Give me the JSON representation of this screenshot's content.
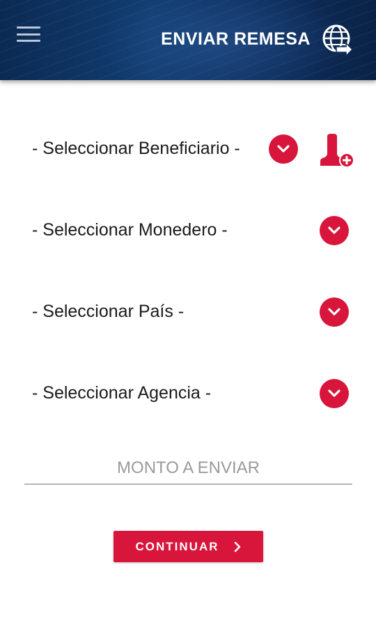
{
  "colors": {
    "header_bg": "#0e2f5f",
    "accent_red": "#d8153a",
    "text_dark": "#1a1a1a",
    "placeholder": "#9a9a9a"
  },
  "header": {
    "menu_icon": "hamburger-menu-icon",
    "title": "ENVIAR REMESA",
    "globe_icon": "globe-send-icon"
  },
  "form": {
    "beneficiario": {
      "label": "- Seleccionar Beneficiario -",
      "icon": "chevron-down-icon"
    },
    "add_beneficiario_icon": "add-user-icon",
    "monedero": {
      "label": "- Seleccionar Monedero -",
      "icon": "chevron-down-icon"
    },
    "pais": {
      "label": "- Seleccionar País -",
      "icon": "chevron-down-icon"
    },
    "agencia": {
      "label": "- Seleccionar Agencia -",
      "icon": "chevron-down-icon"
    },
    "amount": {
      "placeholder": "MONTO A ENVIAR",
      "value": ""
    },
    "continue_button": {
      "label": "CONTINUAR",
      "icon": "chevron-right-icon"
    }
  }
}
